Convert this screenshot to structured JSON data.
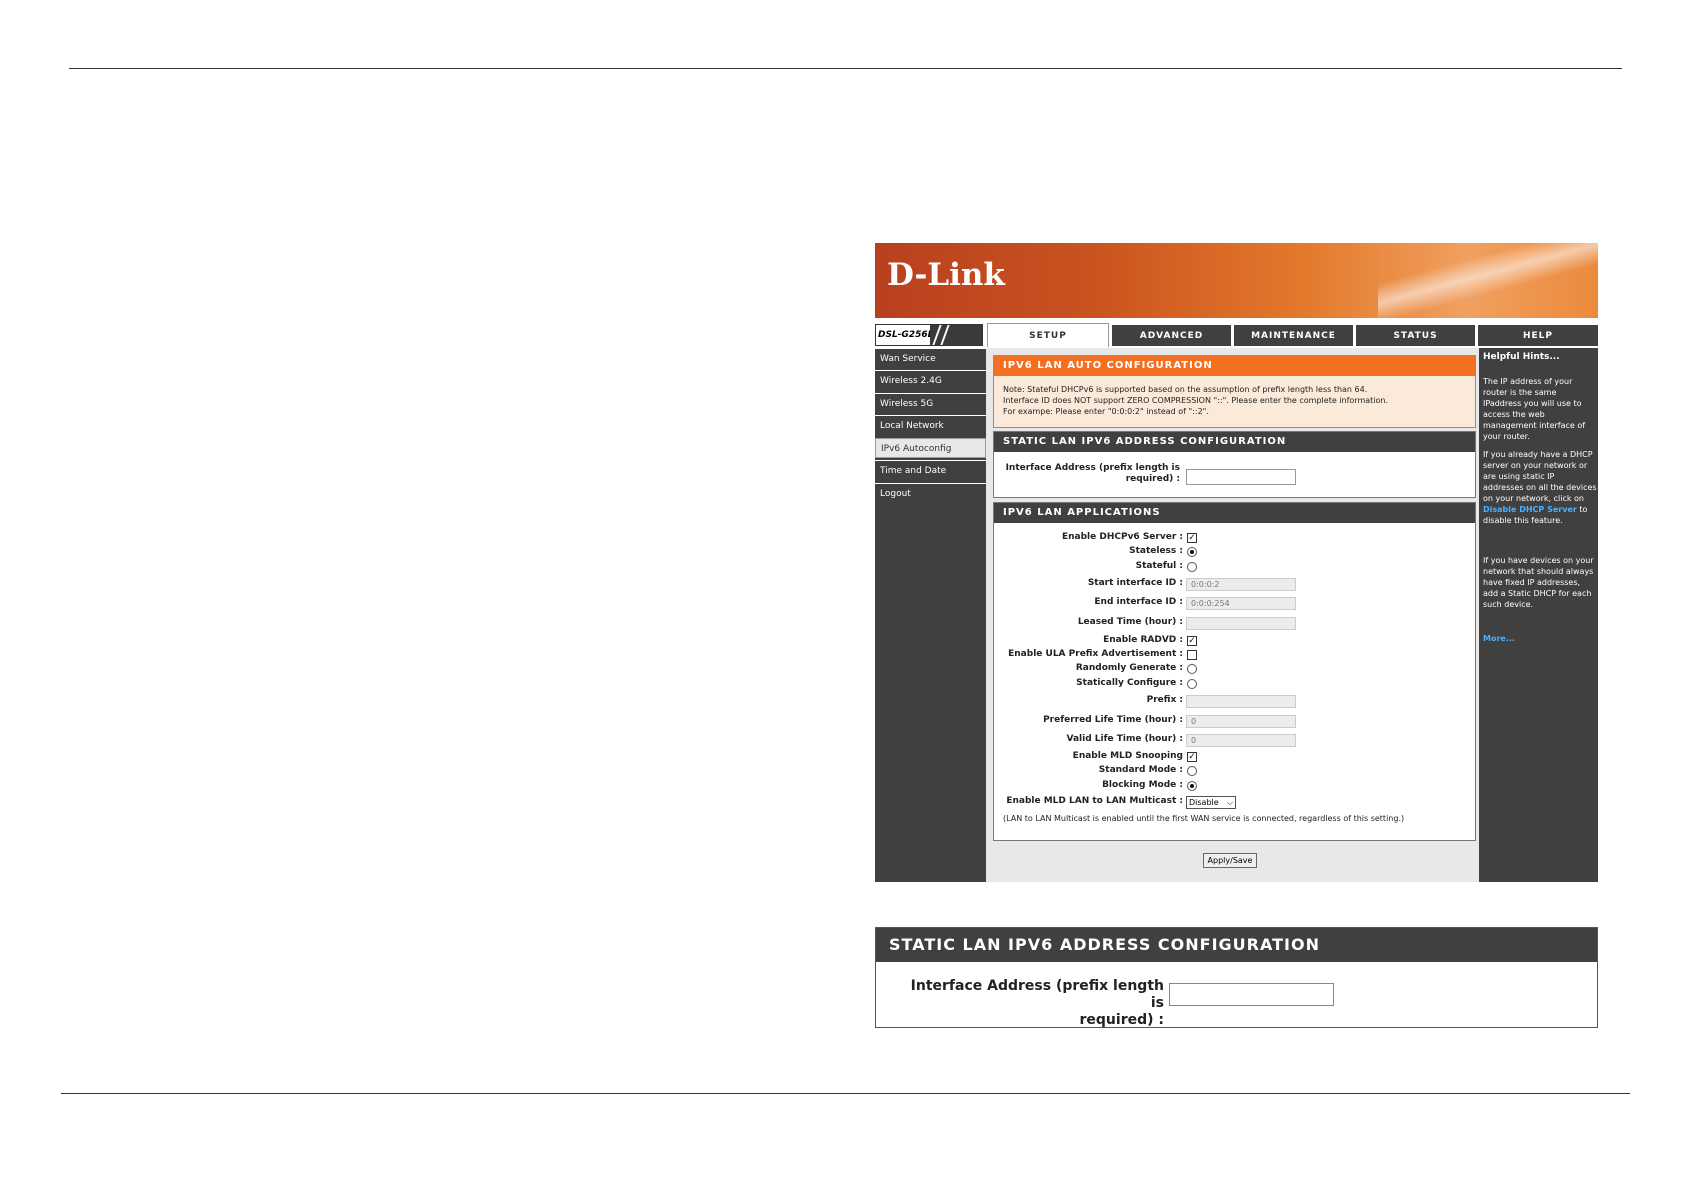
{
  "banner": {
    "logo": "D-Link",
    "model": "DSL-G256DG"
  },
  "tabs": [
    {
      "label": "SETUP",
      "active": true
    },
    {
      "label": "ADVANCED"
    },
    {
      "label": "MAINTENANCE"
    },
    {
      "label": "STATUS"
    },
    {
      "label": "HELP"
    }
  ],
  "sidebar": [
    {
      "label": "Wan Service"
    },
    {
      "label": "Wireless 2.4G"
    },
    {
      "label": "Wireless 5G"
    },
    {
      "label": "Local Network"
    },
    {
      "label": "IPv6 Autoconfig",
      "active": true
    },
    {
      "label": "Time and Date"
    },
    {
      "label": "Logout"
    }
  ],
  "auto": {
    "title": "IPV6 LAN AUTO CONFIGURATION",
    "note1": "Note: Stateful DHCPv6 is supported based on the assumption of prefix length less than 64.",
    "note2": "Interface ID does NOT support ZERO COMPRESSION \"::\". Please enter the complete information.",
    "note3": "For exampe: Please enter \"0:0:0:2\" instead of \"::2\"."
  },
  "static": {
    "title": "STATIC LAN IPV6 ADDRESS CONFIGURATION",
    "iface_label_1": "Interface Address (prefix length is",
    "iface_label_2": "required) :",
    "iface_value": ""
  },
  "apps": {
    "title": "IPV6 LAN APPLICATIONS",
    "enable_dhcpv6": "Enable DHCPv6 Server :",
    "stateless": "Stateless :",
    "stateful": "Stateful :",
    "start_id": "Start interface ID :",
    "start_id_value": "0:0:0:2",
    "end_id": "End interface ID :",
    "end_id_value": "0:0:0:254",
    "leased": "Leased Time (hour) :",
    "leased_value": "",
    "enable_radvd": "Enable RADVD :",
    "enable_ula": "Enable ULA Prefix Advertisement :",
    "random": "Randomly Generate :",
    "static_cfg": "Statically Configure :",
    "prefix": "Prefix :",
    "prefix_value": "",
    "preferred": "Preferred Life Time (hour) :",
    "preferred_value": "0",
    "valid": "Valid Life Time (hour) :",
    "valid_value": "0",
    "mld_snoop": "Enable MLD Snooping",
    "standard": "Standard Mode :",
    "blocking": "Blocking Mode :",
    "mld_lan": "Enable MLD LAN to LAN Multicast :",
    "mld_lan_value": "Disable",
    "mld_note": "(LAN to LAN Multicast is enabled until the first WAN service is connected, regardless of this setting.)",
    "check_dhcpv6": "✓",
    "check_radvd": "✓",
    "check_mld": "✓"
  },
  "apply_label": "Apply/Save",
  "help": {
    "title": "Helpful Hints...",
    "p1": "The IP address of your router is the same IPaddress you will use to access the web management interface of your router.",
    "p2a": "If you already have a DHCP server on your network or are using static IP addresses on all the devices on your network, click on",
    "p2link": "Disable DHCP Server",
    "p2b": "to disable this feature.",
    "p3": "If you have devices on your network that should always have fixed IP addresses, add a Static DHCP for each such device.",
    "more": "More..."
  },
  "inset": {
    "title": "STATIC LAN IPV6 ADDRESS CONFIGURATION",
    "label_1": "Interface Address (prefix length is",
    "label_2": "required) :",
    "value": ""
  }
}
